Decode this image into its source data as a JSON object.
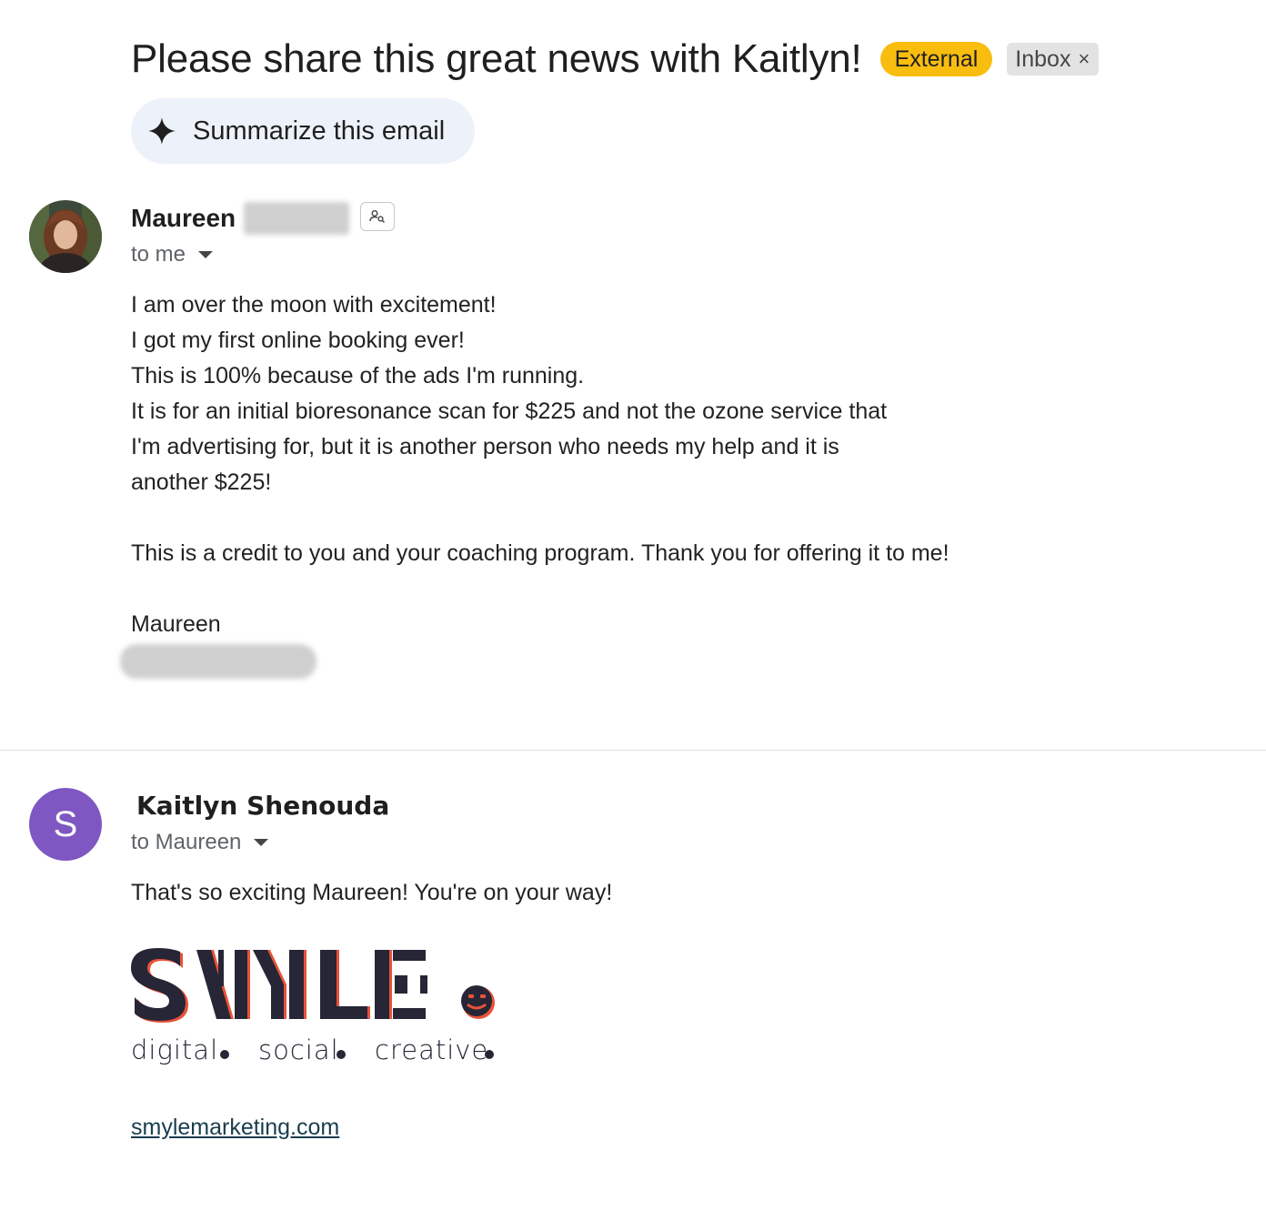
{
  "subject": "Please share this great news with Kaitlyn!",
  "labels": {
    "external": "External",
    "inbox": "Inbox",
    "inbox_remove": "×"
  },
  "summarize_label": "Summarize this email",
  "message1": {
    "sender_first_name": "Maureen",
    "recipient": "to me",
    "body_lines": [
      "I am over the moon with excitement!",
      "I got my first online booking ever!",
      "This is 100% because of the ads I'm running.",
      "It is for an initial bioresonance scan for $225 and not the ozone service that",
      "I'm advertising for, but it is another person who needs my help and it is",
      "another $225!"
    ],
    "paragraph2": "This is a credit to you and your coaching program. Thank you for offering it to me!",
    "signature": "Maureen"
  },
  "message2": {
    "avatar_letter": "S",
    "sender": "Kaitlyn Shenouda",
    "recipient": "to Maureen",
    "body": "That's so exciting Maureen! You're on your way!",
    "logo": {
      "wordmark": "SMYLE",
      "tagline": [
        "digital",
        "social",
        "creative"
      ]
    },
    "link": "smylemarketing.com"
  },
  "colors": {
    "external_badge": "#f9bd10",
    "avatar_purple": "#7e57c2",
    "logo_navy": "#262636",
    "logo_accent": "#e8533a"
  }
}
